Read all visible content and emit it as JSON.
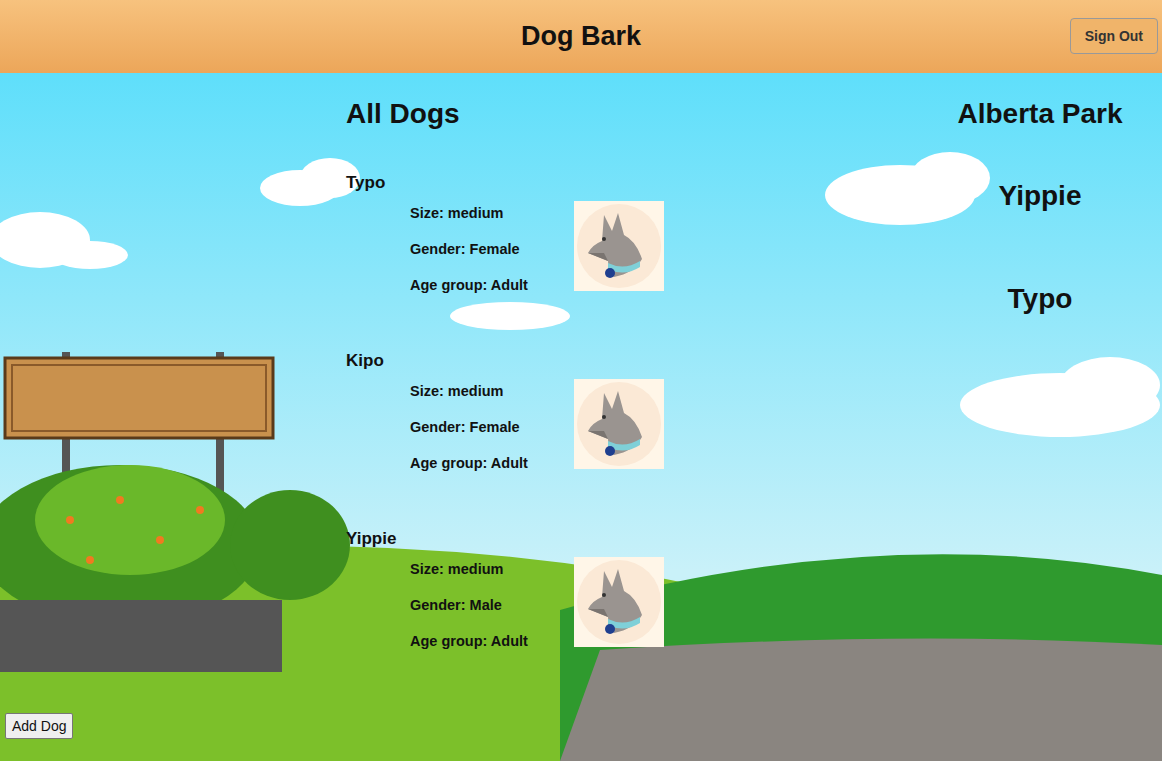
{
  "header": {
    "title": "Dog Bark",
    "sign_out": "Sign Out"
  },
  "all_dogs": {
    "title": "All Dogs",
    "dogs": [
      {
        "name": "Typo",
        "details": [
          "Size: medium",
          "Gender: Female",
          "Age group: Adult"
        ]
      },
      {
        "name": "Kipo",
        "details": [
          "Size: medium",
          "Gender: Female",
          "Age group: Adult"
        ]
      },
      {
        "name": "Yippie",
        "details": [
          "Size: medium",
          "Gender: Male",
          "Age group: Adult"
        ]
      }
    ]
  },
  "park": {
    "title": "Alberta Park",
    "dogs": [
      "Yippie",
      "Typo"
    ]
  },
  "add_dog": "Add Dog"
}
